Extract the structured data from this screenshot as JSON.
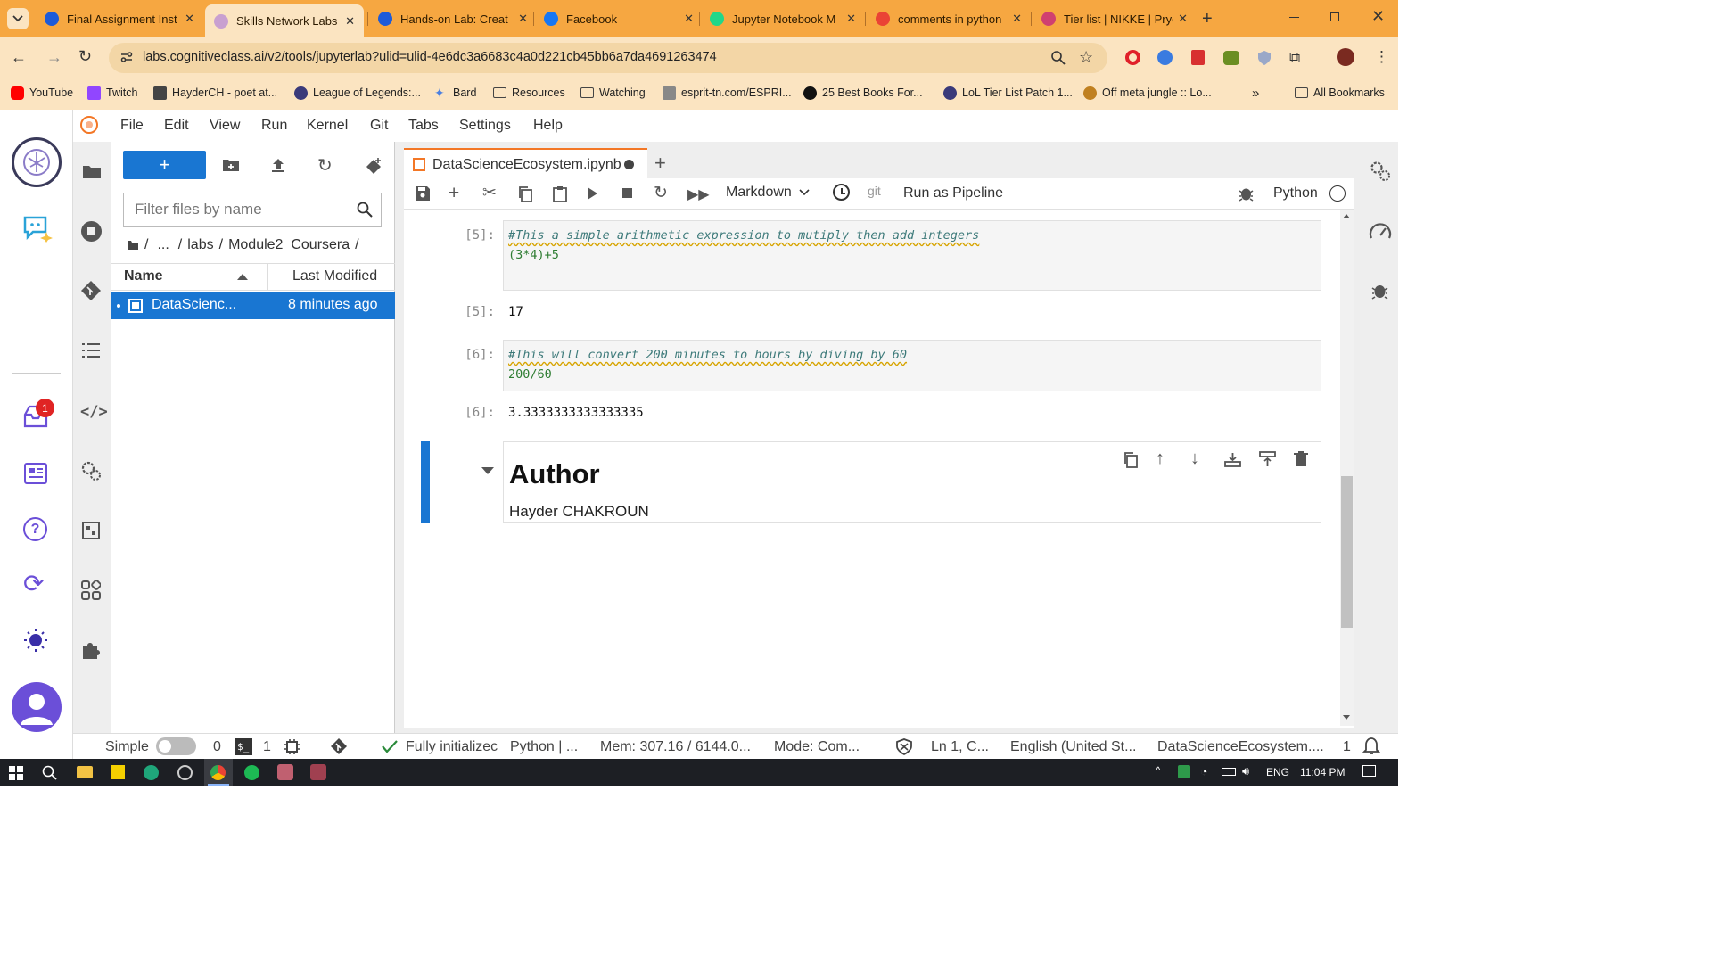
{
  "browser": {
    "tabs": [
      {
        "title": "Final Assignment Inst",
        "icon": "coursera-icon",
        "color": "#1e5bd8"
      },
      {
        "title": "Skills Network Labs",
        "icon": "skills-network-icon",
        "color": "#c9a0d0",
        "active": true
      },
      {
        "title": "Hands-on Lab: Creat",
        "icon": "coursera-icon",
        "color": "#1e5bd8"
      },
      {
        "title": "Facebook",
        "icon": "facebook-icon",
        "color": "#1877f2"
      },
      {
        "title": "Jupyter Notebook M",
        "icon": "pycharm-icon",
        "color": "#21d789"
      },
      {
        "title": "comments in python",
        "icon": "google-icon",
        "color": "#ea4335"
      },
      {
        "title": "Tier list | NIKKE | Pryc",
        "icon": "nikke-icon",
        "color": "#d04070"
      }
    ],
    "url": "labs.cognitiveclass.ai/v2/tools/jupyterlab?ulid=ulid-4e6dc3a6683c4a0d221cb45bb6a7da4691263474",
    "bookmarks": [
      "YouTube",
      "Twitch",
      "HayderCH - poet at...",
      "League of Legends:...",
      "Bard",
      "Resources",
      "Watching",
      "esprit-tn.com/ESPRI...",
      "25 Best Books For...",
      "LoL Tier List Patch 1...",
      "Off meta jungle :: Lo..."
    ],
    "all_bookmarks": "All Bookmarks",
    "overflow": "»"
  },
  "jupyter": {
    "menu": [
      "File",
      "Edit",
      "View",
      "Run",
      "Kernel",
      "Git",
      "Tabs",
      "Settings",
      "Help"
    ],
    "left_badge": "1",
    "filter_placeholder": "Filter files by name",
    "breadcrumb": {
      "dots": "...",
      "sep": "/",
      "labs": "labs",
      "module": "Module2_Coursera"
    },
    "file_columns": {
      "name": "Name",
      "modified": "Last Modified"
    },
    "files": [
      {
        "name": "DataScienc...",
        "modified": "8 minutes ago"
      }
    ],
    "doc_tab": "DataScienceEcosystem.ipynb",
    "toolbar": {
      "cell_type": "Markdown",
      "git": "git",
      "pipeline": "Run as Pipeline",
      "kernel": "Python"
    },
    "cells": [
      {
        "prompt": "[5]:",
        "comment": "#This a simple arithmetic expression to mutiply then add integers",
        "code": "(3*4)+5",
        "out_prompt": "[5]:",
        "output": "17"
      },
      {
        "prompt": "[6]:",
        "comment": "#This will convert 200 minutes to hours by diving by 60",
        "code": "200/60",
        "out_prompt": "[6]:",
        "output": "3.3333333333333335"
      }
    ],
    "markdown": {
      "heading": "Author",
      "body": "Hayder CHAKROUN"
    },
    "status": {
      "mode_label": "Simple",
      "count0": "0",
      "count1": "1",
      "init": "Fully initializec",
      "kernel": "Python | ...",
      "mem": "Mem: 307.16 / 6144.0...",
      "mode": "Mode: Com...",
      "pos": "Ln 1, C...",
      "lang": "English (United St...",
      "file": "DataScienceEcosystem....",
      "notif": "1"
    }
  },
  "taskbar": {
    "lang": "ENG",
    "time": "11:04 PM"
  }
}
